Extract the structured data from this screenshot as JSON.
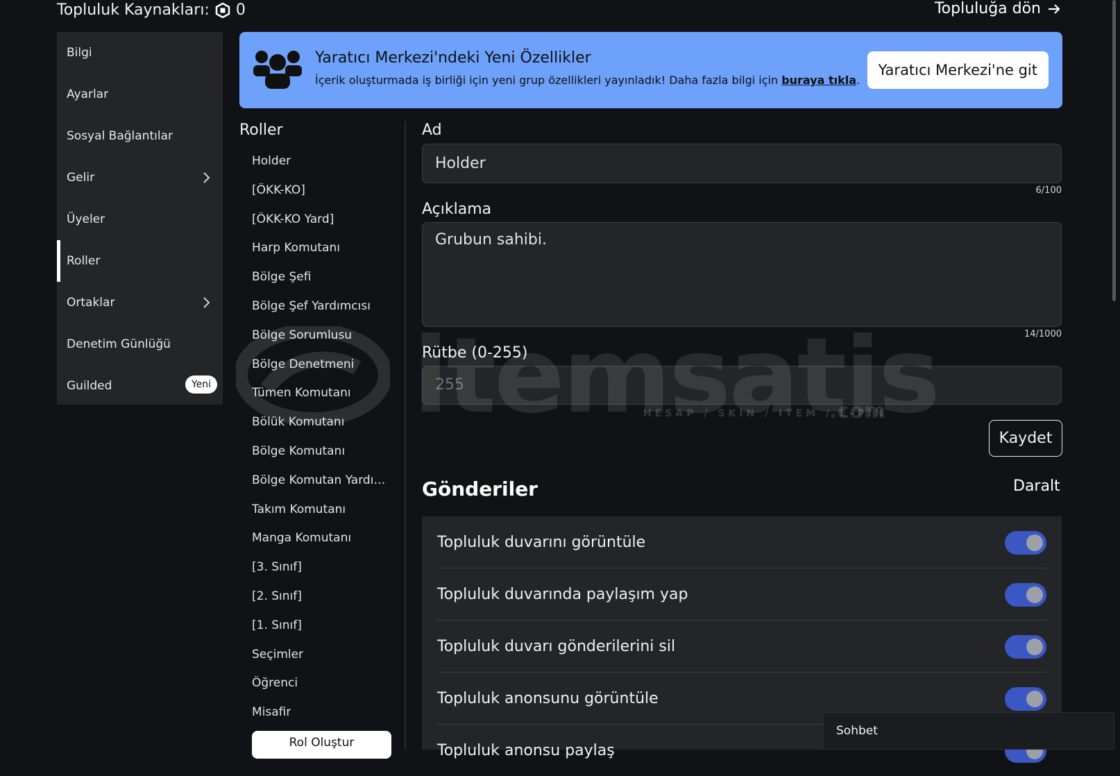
{
  "header": {
    "resources_label": "Topluluk Kaynakları:",
    "resources_value": "0",
    "back_label": "Topluluğa dön"
  },
  "sidebar": {
    "items": [
      {
        "label": "Bilgi"
      },
      {
        "label": "Ayarlar"
      },
      {
        "label": "Sosyal Bağlantılar"
      },
      {
        "label": "Gelir"
      },
      {
        "label": "Üyeler"
      },
      {
        "label": "Roller"
      },
      {
        "label": "Ortaklar"
      },
      {
        "label": "Denetim Günlüğü"
      },
      {
        "label": "Guilded",
        "badge": "Yeni"
      }
    ],
    "active": "Roller"
  },
  "banner": {
    "title": "Yaratıcı Merkezi'ndeki Yeni Özellikler",
    "text": "İçerik oluşturmada iş birliği için yeni grup özellikleri yayınladık! Daha fazla bilgi için ",
    "link": "buraya tıkla",
    "text_end": ".",
    "button": "Yaratıcı Merkezi'ne git",
    "color": "#6ea1fa"
  },
  "roles": {
    "heading": "Roller",
    "items": [
      "Holder",
      "[ÖKK-KO]",
      "[ÖKK-KO Yard]",
      "Harp Komutanı",
      "Bölge Şefi",
      "Bölge Şef Yardımcısı",
      "Bölge Sorumlusu",
      "Bölge Denetmeni",
      "Tümen Komutanı",
      "Bölük Komutanı",
      "Bölge Komutanı",
      "Bölge Komutan Yardımcısı",
      "Takım Komutanı",
      "Manga Komutanı",
      "[3. Sınıf]",
      "[2. Sınıf]",
      "[1. Sınıf]",
      "Seçimler",
      "Öğrenci",
      "Misafir"
    ],
    "create_button": "Rol Oluştur"
  },
  "form": {
    "name_label": "Ad",
    "name_value": "Holder",
    "name_counter": "6/100",
    "desc_label": "Açıklama",
    "desc_value": "Grubun sahibi.",
    "desc_counter": "14/1000",
    "rank_label": "Rütbe (0-255)",
    "rank_value": "255",
    "save_button": "Kaydet"
  },
  "posts": {
    "title": "Gönderiler",
    "collapse": "Daralt",
    "permissions": [
      {
        "label": "Topluluk duvarını görüntüle",
        "enabled": true
      },
      {
        "label": "Topluluk duvarında paylaşım yap",
        "enabled": true
      },
      {
        "label": "Topluluk duvarı gönderilerini sil",
        "enabled": true
      },
      {
        "label": "Topluluk anonsunu görüntüle",
        "enabled": true
      },
      {
        "label": "Topluluk anonsu paylaş",
        "enabled": true
      }
    ],
    "toggle_color": "#3a57c4"
  },
  "chat": {
    "label": "Sohbet"
  },
  "watermark": {
    "brand": "itemsatis",
    "tagline": "HESAP / SKIN / ITEM / E-PIN",
    "suffix": ".com"
  }
}
